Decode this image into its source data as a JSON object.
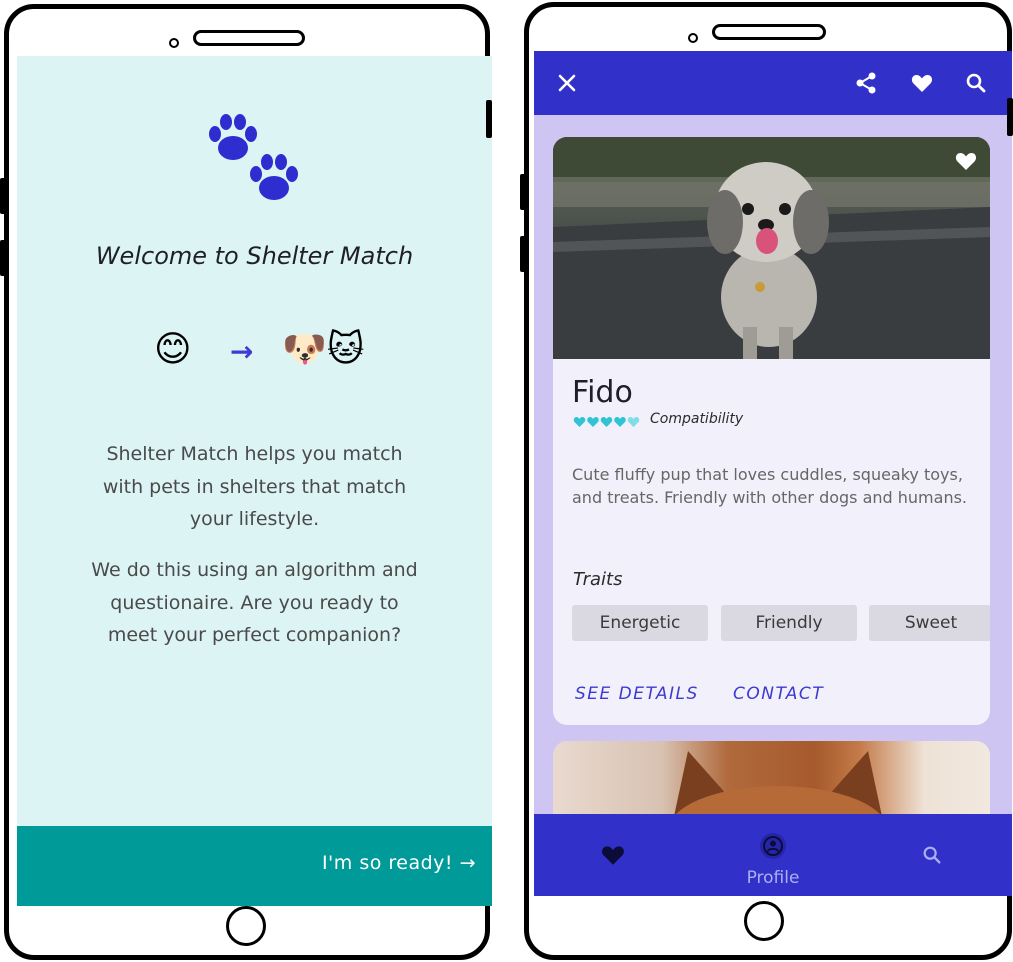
{
  "welcome": {
    "title": "Welcome to Shelter Match",
    "emoji_face": "😊",
    "arrow": "→",
    "emoji_pets": "🐶🐱",
    "paragraph1": "Shelter Match helps you match with pets in shelters that match your lifestyle.",
    "paragraph2": "We do this using an algorithm and questionaire. Are you ready to meet your perfect companion?",
    "ready_button": "I'm so ready! →"
  },
  "pet_screen": {
    "topbar_icons": [
      "close-icon",
      "share-icon",
      "heart-icon",
      "search-icon"
    ],
    "pet": {
      "name": "Fido",
      "compatibility_label": "Compatibility",
      "compatibility_hearts": 5,
      "description": "Cute fluffy pup that loves cuddles, squeaky toys, and treats. Friendly with other dogs and humans.",
      "traits_title": "Traits",
      "traits": [
        "Energetic",
        "Friendly",
        "Sweet"
      ],
      "see_details": "SEE DETAILS",
      "contact": "CONTACT"
    },
    "bottom_nav": {
      "items": [
        {
          "icon": "heart-icon",
          "label": ""
        },
        {
          "icon": "profile-icon",
          "label": "Profile"
        },
        {
          "icon": "search-icon",
          "label": ""
        }
      ]
    }
  },
  "colors": {
    "primary": "#3131c9",
    "teal_button": "#009b98",
    "welcome_bg": "#ddf4f4",
    "pet_bg": "#cfc5f3",
    "paw": "#2e2ed0",
    "accent_text": "#3c3ad0",
    "heart_cyan": "#2ec4d6"
  }
}
